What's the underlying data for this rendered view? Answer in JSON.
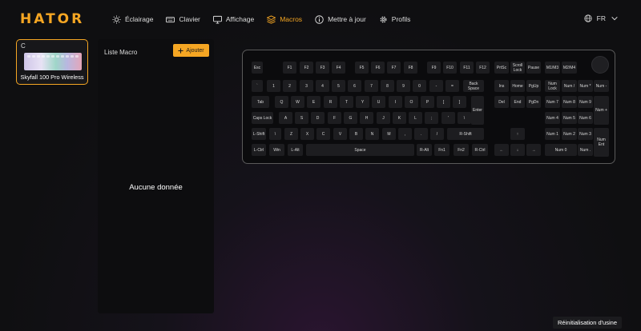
{
  "app": {
    "logo": "HATOR"
  },
  "nav": [
    {
      "label": "Éclairage",
      "icon": "sun-icon"
    },
    {
      "label": "Clavier",
      "icon": "keyboard-icon"
    },
    {
      "label": "Affichage",
      "icon": "monitor-icon"
    },
    {
      "label": "Macros",
      "icon": "layers-icon",
      "active": true
    },
    {
      "label": "Mettre à jour",
      "icon": "info-icon"
    },
    {
      "label": "Profils",
      "icon": "gear-icon"
    }
  ],
  "language": {
    "label": "FR",
    "icon": "globe-icon"
  },
  "device": {
    "mark": "C",
    "name": "Skyfall 100 Pro Wireless"
  },
  "macro_panel": {
    "title": "Liste Macro",
    "add_label": "Ajouter",
    "empty_text": "Aucune donnée"
  },
  "reset_label": "Réinitialisation d'usine",
  "accent_color": "#f5a623",
  "keys": [
    "Esc",
    "F1",
    "F2",
    "F3",
    "F4",
    "F5",
    "F6",
    "F7",
    "F8",
    "F9",
    "F10",
    "F11",
    "F12",
    "PrtSc",
    "Scroll Lock",
    "Pause",
    "M1/M3",
    "M2/M4",
    "`",
    "1",
    "2",
    "3",
    "4",
    "5",
    "6",
    "7",
    "8",
    "9",
    "0",
    "-",
    "=",
    "Back Space",
    "Ins",
    "Home",
    "PgUp",
    "Num Lock",
    "Num /",
    "Num *",
    "Num -",
    "Tab",
    "Q",
    "W",
    "E",
    "R",
    "T",
    "Y",
    "U",
    "I",
    "O",
    "P",
    "[",
    "]",
    "Enter",
    "Del",
    "End",
    "PgDn",
    "Num 7",
    "Num 8",
    "Num 9",
    "Num +",
    "Caps Lock",
    "A",
    "S",
    "D",
    "F",
    "G",
    "H",
    "J",
    "K",
    "L",
    ";",
    "'",
    "\\",
    "Num 4",
    "Num 5",
    "Num 6",
    "L-Shift",
    "\\",
    "Z",
    "X",
    "C",
    "V",
    "B",
    "N",
    "M",
    ",",
    ".",
    "/",
    "R-Shift",
    "↑",
    "Num 1",
    "Num 2",
    "Num 3",
    "Num Ent",
    "L-Ctrl",
    "Win",
    "L-Alt",
    "Space",
    "R-Alt",
    "Fn1",
    "Fn2",
    "R-Ctrl",
    "←",
    "↓",
    "→",
    "Num 0",
    "Num ."
  ]
}
